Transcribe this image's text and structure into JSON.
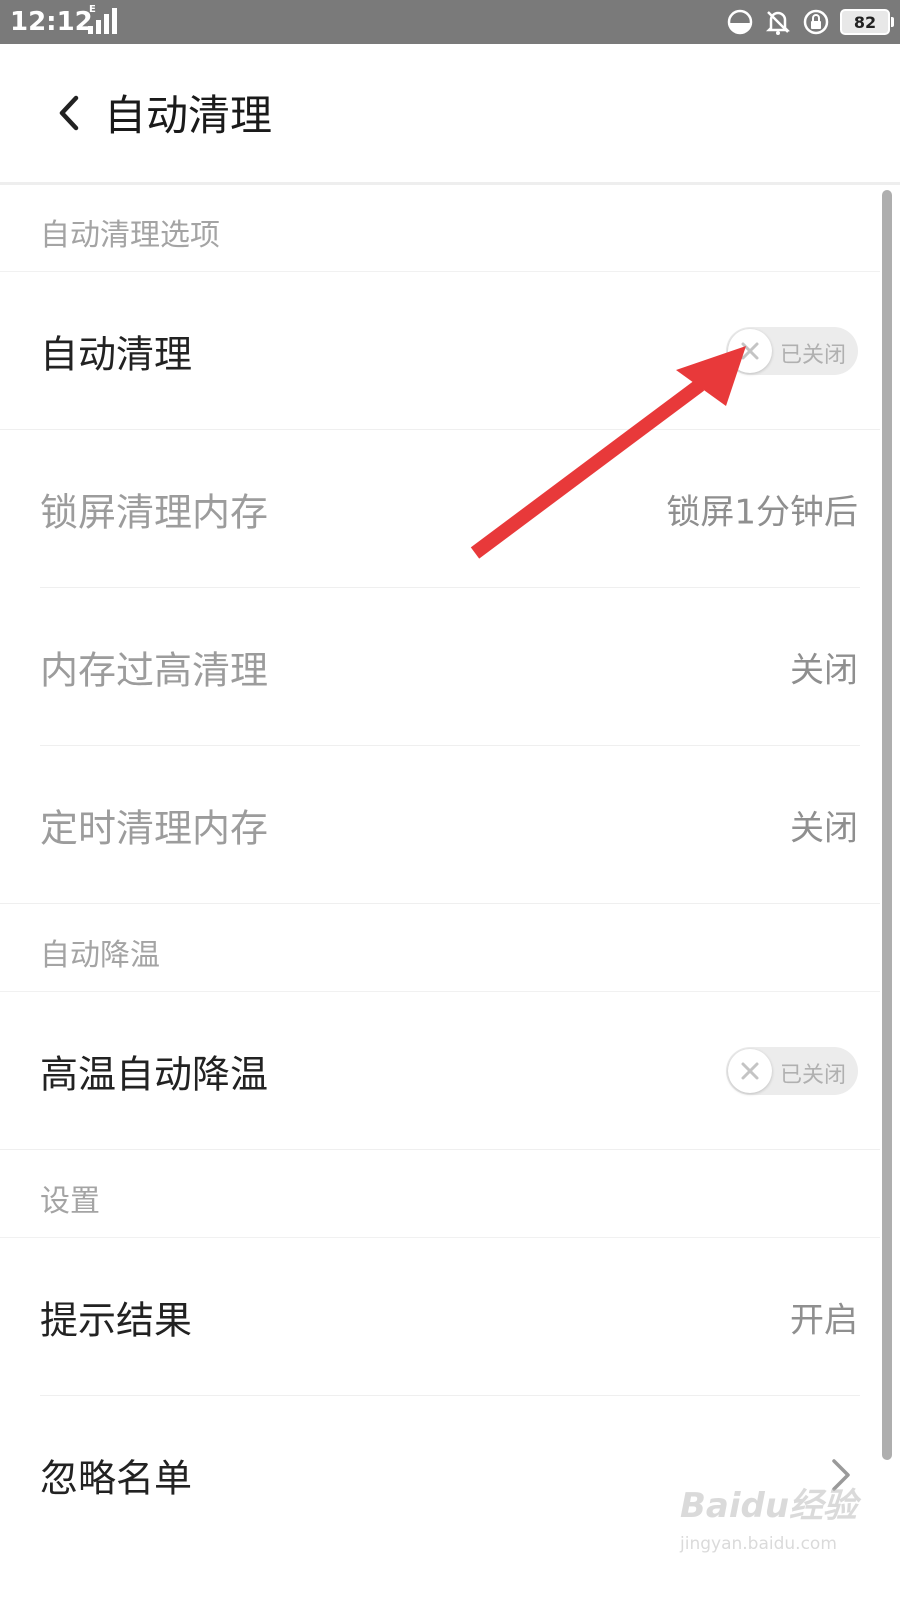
{
  "status_bar": {
    "time": "12:12",
    "network": "E",
    "battery": "82"
  },
  "header": {
    "title": "自动清理"
  },
  "sections": {
    "auto_clean_options": {
      "header": "自动清理选项",
      "auto_clean": {
        "label": "自动清理",
        "switch_text": "已关闭"
      },
      "lock_screen": {
        "label": "锁屏清理内存",
        "value": "锁屏1分钟后"
      },
      "memory_high": {
        "label": "内存过高清理",
        "value": "关闭"
      },
      "scheduled": {
        "label": "定时清理内存",
        "value": "关闭"
      }
    },
    "auto_cool": {
      "header": "自动降温",
      "high_temp": {
        "label": "高温自动降温",
        "switch_text": "已关闭"
      }
    },
    "settings": {
      "header": "设置",
      "show_result": {
        "label": "提示结果",
        "value": "开启"
      },
      "ignore_list": {
        "label": "忽略名单"
      }
    }
  },
  "watermark": {
    "logo": "Baidu经验",
    "url": "jingyan.baidu.com"
  },
  "colors": {
    "status_bar": "#7a7a7a",
    "annotation_arrow": "#e8393a",
    "switch_off": "#ececec"
  },
  "icons": {
    "back": "chevron-left-icon",
    "row_arrow": "chevron-right-icon",
    "switch_off": "close-icon"
  }
}
